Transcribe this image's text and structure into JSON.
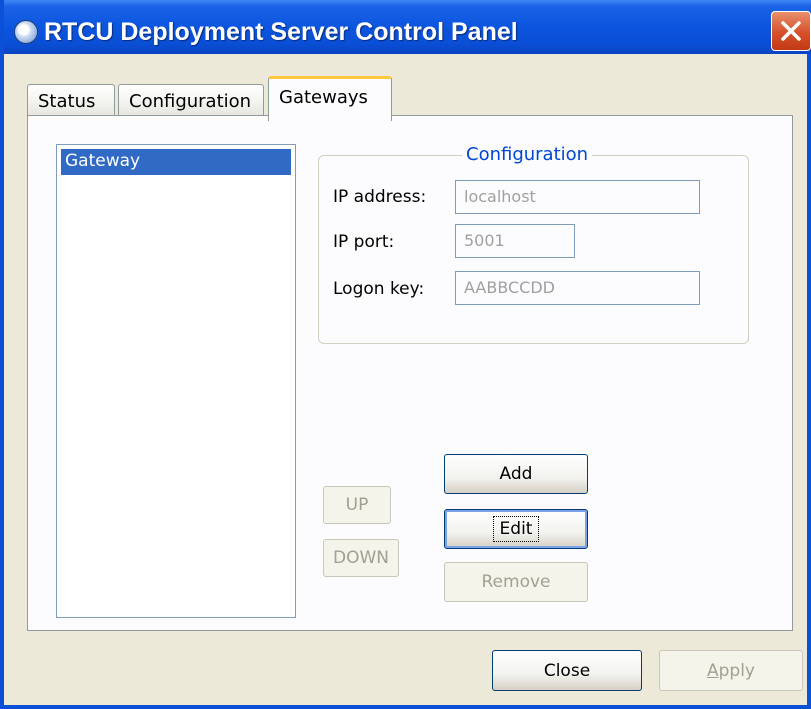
{
  "window": {
    "title": "RTCU Deployment Server Control Panel"
  },
  "tabs": [
    {
      "label": "Status"
    },
    {
      "label": "Configuration"
    },
    {
      "label": "Gateways"
    }
  ],
  "gateways": {
    "list_items": [
      "Gateway"
    ],
    "configuration": {
      "title": "Configuration",
      "ip_address_label": "IP address:",
      "ip_address_value": "localhost",
      "ip_port_label": "IP port:",
      "ip_port_value": "5001",
      "logon_key_label": "Logon key:",
      "logon_key_value": "AABBCCDD"
    },
    "buttons": {
      "up": "UP",
      "down": "DOWN",
      "add": "Add",
      "edit": "Edit",
      "remove": "Remove"
    }
  },
  "footer": {
    "close": "Close",
    "apply": "Apply"
  },
  "icons": {
    "app": "globe-icon",
    "close": "close-icon"
  },
  "colors": {
    "title_bar": "#0a4fd6",
    "selection": "#316ac5",
    "group_title": "#0046d5",
    "active_tab_accent": "#ffc83c"
  }
}
